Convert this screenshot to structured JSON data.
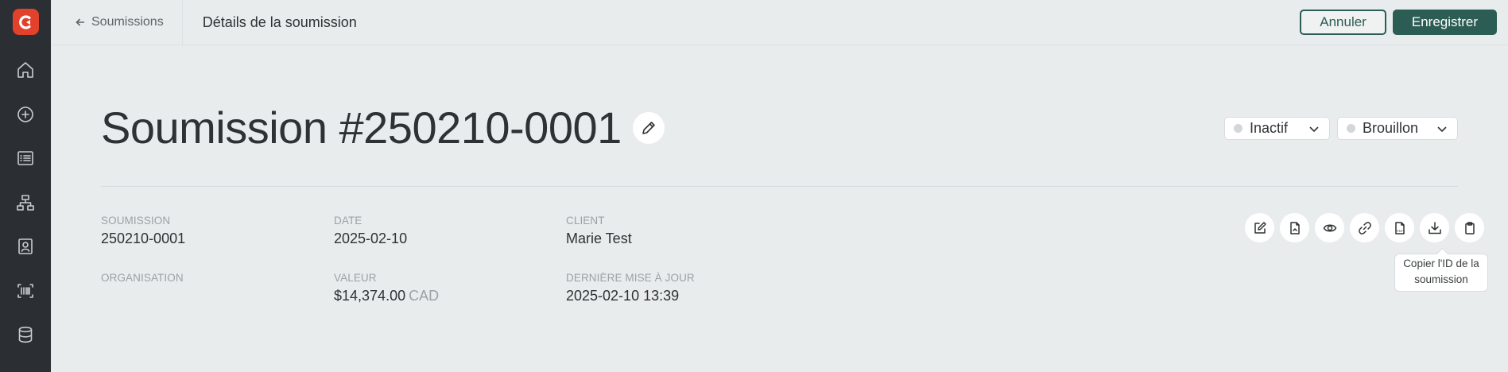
{
  "app": {
    "brand_color": "#e2412b",
    "accent_color": "#2c5d54"
  },
  "sidebar": {
    "items": [
      {
        "icon": "home-icon"
      },
      {
        "icon": "plus-circle-icon"
      },
      {
        "icon": "list-icon"
      },
      {
        "icon": "sitemap-icon"
      },
      {
        "icon": "contacts-icon"
      },
      {
        "icon": "barcode-icon"
      },
      {
        "icon": "database-icon"
      }
    ]
  },
  "topbar": {
    "back_label": "Soumissions",
    "title": "Détails de la soumission",
    "cancel_label": "Annuler",
    "save_label": "Enregistrer"
  },
  "header": {
    "title": "Soumission #250210-0001",
    "status_1": "Inactif",
    "status_2": "Brouillon"
  },
  "details": {
    "soumission_label": "SOUMISSION",
    "soumission_value": "250210-0001",
    "date_label": "DATE",
    "date_value": "2025-02-10",
    "client_label": "CLIENT",
    "client_value": "Marie Test",
    "organisation_label": "ORGANISATION",
    "valeur_label": "VALEUR",
    "valeur_value": "$14,374.00",
    "valeur_unit": "CAD",
    "maj_label": "DERNIÈRE MISE À JOUR",
    "maj_value": "2025-02-10 13:39"
  },
  "actions": {
    "icons": [
      "edit-icon",
      "file-icon",
      "eye-icon",
      "link-icon",
      "pdf-icon",
      "download-icon",
      "clipboard-icon"
    ],
    "pdf_glyph": "PDF",
    "tooltip": "Copier l'ID de la soumission"
  }
}
